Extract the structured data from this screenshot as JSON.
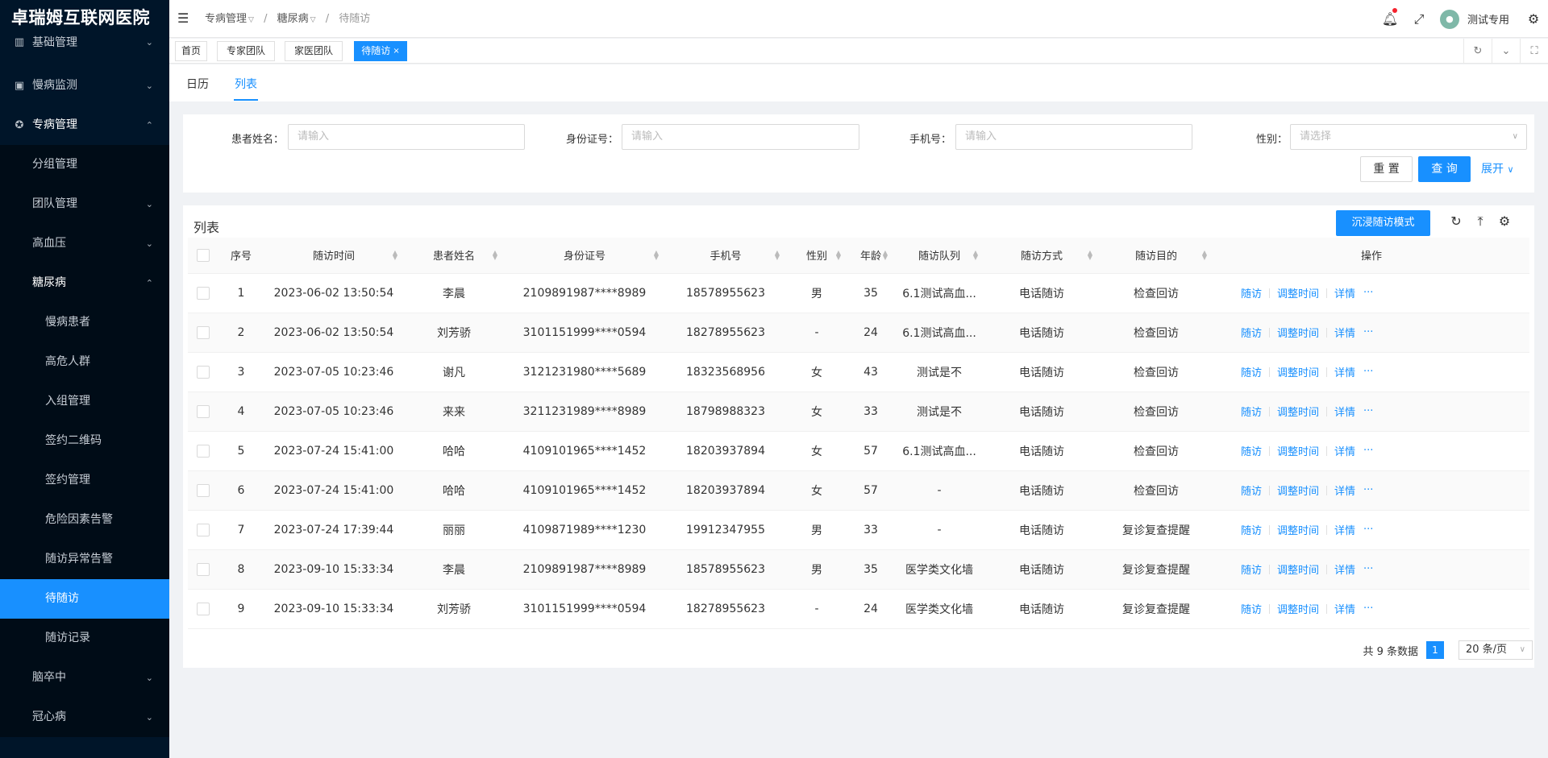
{
  "sidebar": {
    "logo": "卓瑞姆互联网医院",
    "items": [
      {
        "label": "基础管理",
        "icon": "grid-icon",
        "arrow": "⌄"
      },
      {
        "label": "慢病监测",
        "icon": "monitor-icon",
        "arrow": "⌄"
      },
      {
        "label": "专病管理",
        "icon": "award-icon",
        "arrow": "⌃"
      },
      {
        "label": "分组管理"
      },
      {
        "label": "团队管理",
        "arrow": "⌄"
      },
      {
        "label": "高血压",
        "arrow": "⌄"
      },
      {
        "label": "糖尿病",
        "arrow": "⌃"
      },
      {
        "label": "慢病患者"
      },
      {
        "label": "高危人群"
      },
      {
        "label": "入组管理"
      },
      {
        "label": "签约二维码"
      },
      {
        "label": "签约管理"
      },
      {
        "label": "危险因素告警"
      },
      {
        "label": "随访异常告警"
      },
      {
        "label": "待随访"
      },
      {
        "label": "随访记录"
      },
      {
        "label": "脑卒中",
        "arrow": "⌄"
      },
      {
        "label": "冠心病",
        "arrow": "⌄"
      }
    ]
  },
  "header": {
    "breadcrumb": [
      "专病管理",
      "糖尿病",
      "待随访"
    ],
    "username": "测试专用"
  },
  "tabs": [
    {
      "label": "首页"
    },
    {
      "label": "专家团队"
    },
    {
      "label": "家医团队"
    },
    {
      "label": "待随访",
      "close": "×"
    }
  ],
  "subtabs": [
    "日历",
    "列表"
  ],
  "search": {
    "name_label": "患者姓名：",
    "name_placeholder": "请输入",
    "id_label": "身份证号：",
    "id_placeholder": "请输入",
    "phone_label": "手机号：",
    "phone_placeholder": "请输入",
    "gender_label": "性别：",
    "gender_placeholder": "请选择",
    "reset": "重 置",
    "query": "查 询",
    "expand": "展开"
  },
  "table": {
    "title": "列表",
    "immerse_button": "沉浸随访模式",
    "columns": [
      "序号",
      "随访时间",
      "患者姓名",
      "身份证号",
      "手机号",
      "性别",
      "年龄",
      "随访队列",
      "随访方式",
      "随访目的",
      "操作"
    ],
    "rows": [
      [
        "1",
        "2023-06-02 13:50:54",
        "李晨",
        "2109891987****8989",
        "18578955623",
        "男",
        "35",
        "6.1测试高血...",
        "电话随访",
        "检查回访"
      ],
      [
        "2",
        "2023-06-02 13:50:54",
        "刘芳骄",
        "3101151999****0594",
        "18278955623",
        "-",
        "24",
        "6.1测试高血...",
        "电话随访",
        "检查回访"
      ],
      [
        "3",
        "2023-07-05 10:23:46",
        "谢凡",
        "3121231980****5689",
        "18323568956",
        "女",
        "43",
        "测试是不",
        "电话随访",
        "检查回访"
      ],
      [
        "4",
        "2023-07-05 10:23:46",
        "来来",
        "3211231989****8989",
        "18798988323",
        "女",
        "33",
        "测试是不",
        "电话随访",
        "检查回访"
      ],
      [
        "5",
        "2023-07-24 15:41:00",
        "哈哈",
        "4109101965****1452",
        "18203937894",
        "女",
        "57",
        "6.1测试高血...",
        "电话随访",
        "检查回访"
      ],
      [
        "6",
        "2023-07-24 15:41:00",
        "哈哈",
        "4109101965****1452",
        "18203937894",
        "女",
        "57",
        "-",
        "电话随访",
        "检查回访"
      ],
      [
        "7",
        "2023-07-24 17:39:44",
        "丽丽",
        "4109871989****1230",
        "19912347955",
        "男",
        "33",
        "-",
        "电话随访",
        "复诊复查提醒"
      ],
      [
        "8",
        "2023-09-10 15:33:34",
        "李晨",
        "2109891987****8989",
        "18578955623",
        "男",
        "35",
        "医学类文化墙",
        "电话随访",
        "复诊复查提醒"
      ],
      [
        "9",
        "2023-09-10 15:33:34",
        "刘芳骄",
        "3101151999****0594",
        "18278955623",
        "-",
        "24",
        "医学类文化墙",
        "电话随访",
        "复诊复查提醒"
      ]
    ],
    "actions": [
      "随访",
      "调整时间",
      "详情",
      "···"
    ]
  },
  "pagination": {
    "total_text": "共 9 条数据",
    "current_page": "1",
    "page_size": "20 条/页"
  },
  "colors": {
    "primary": "#1890ff",
    "sidebar_bg": "#001529",
    "sidebar_sub_bg": "#000c17"
  }
}
